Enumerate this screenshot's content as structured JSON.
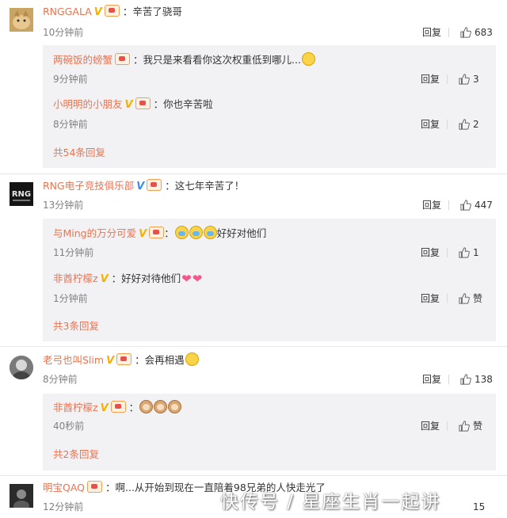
{
  "comments": [
    {
      "username": "RNGGALA",
      "text": "：辛苦了骁哥",
      "time": "10分钟前",
      "reply_label": "回复",
      "likes": "683",
      "replies": [
        {
          "username": "两碗饭的螃蟹",
          "text": "：我只是来看看你这次权重低到哪儿...",
          "time": "9分钟前",
          "reply_label": "回复",
          "likes": "3"
        },
        {
          "username": "小明明的小朋友",
          "text": "：你也辛苦啦",
          "time": "8分钟前",
          "reply_label": "回复",
          "likes": "2"
        }
      ],
      "more_replies": "共54条回复"
    },
    {
      "username": "RNG电子竞技俱乐部",
      "text": "：这七年辛苦了！",
      "time": "13分钟前",
      "reply_label": "回复",
      "likes": "447",
      "replies": [
        {
          "username": "与Ming的万分可爱",
          "text": "好好对他们",
          "time": "11分钟前",
          "reply_label": "回复",
          "likes": "1"
        },
        {
          "username": "非酋柠檬z",
          "text": "：好好对待他们",
          "time": "1分钟前",
          "reply_label": "回复",
          "likes": "赞"
        }
      ],
      "more_replies": "共3条回复"
    },
    {
      "username": "老弓也叫Slim",
      "text": "：会再相遇",
      "time": "8分钟前",
      "reply_label": "回复",
      "likes": "138",
      "replies": [
        {
          "username": "非酋柠檬z",
          "text": "：",
          "time": "40秒前",
          "reply_label": "回复",
          "likes": "赞"
        }
      ],
      "more_replies": "共2条回复"
    },
    {
      "username": "明宝QAQ",
      "text": "：啊...从开始到现在一直陪着98兄弟的人快走光了",
      "time": "12分钟前",
      "reply_label": "回复",
      "likes": "15"
    }
  ],
  "watermark": "快传号 / 星座生肖一起讲",
  "colors": {
    "username": "#eb7350",
    "reply_bg": "#f2f2f5",
    "vip_gold": "#f5b000",
    "vip_blue": "#3a8ee6"
  }
}
